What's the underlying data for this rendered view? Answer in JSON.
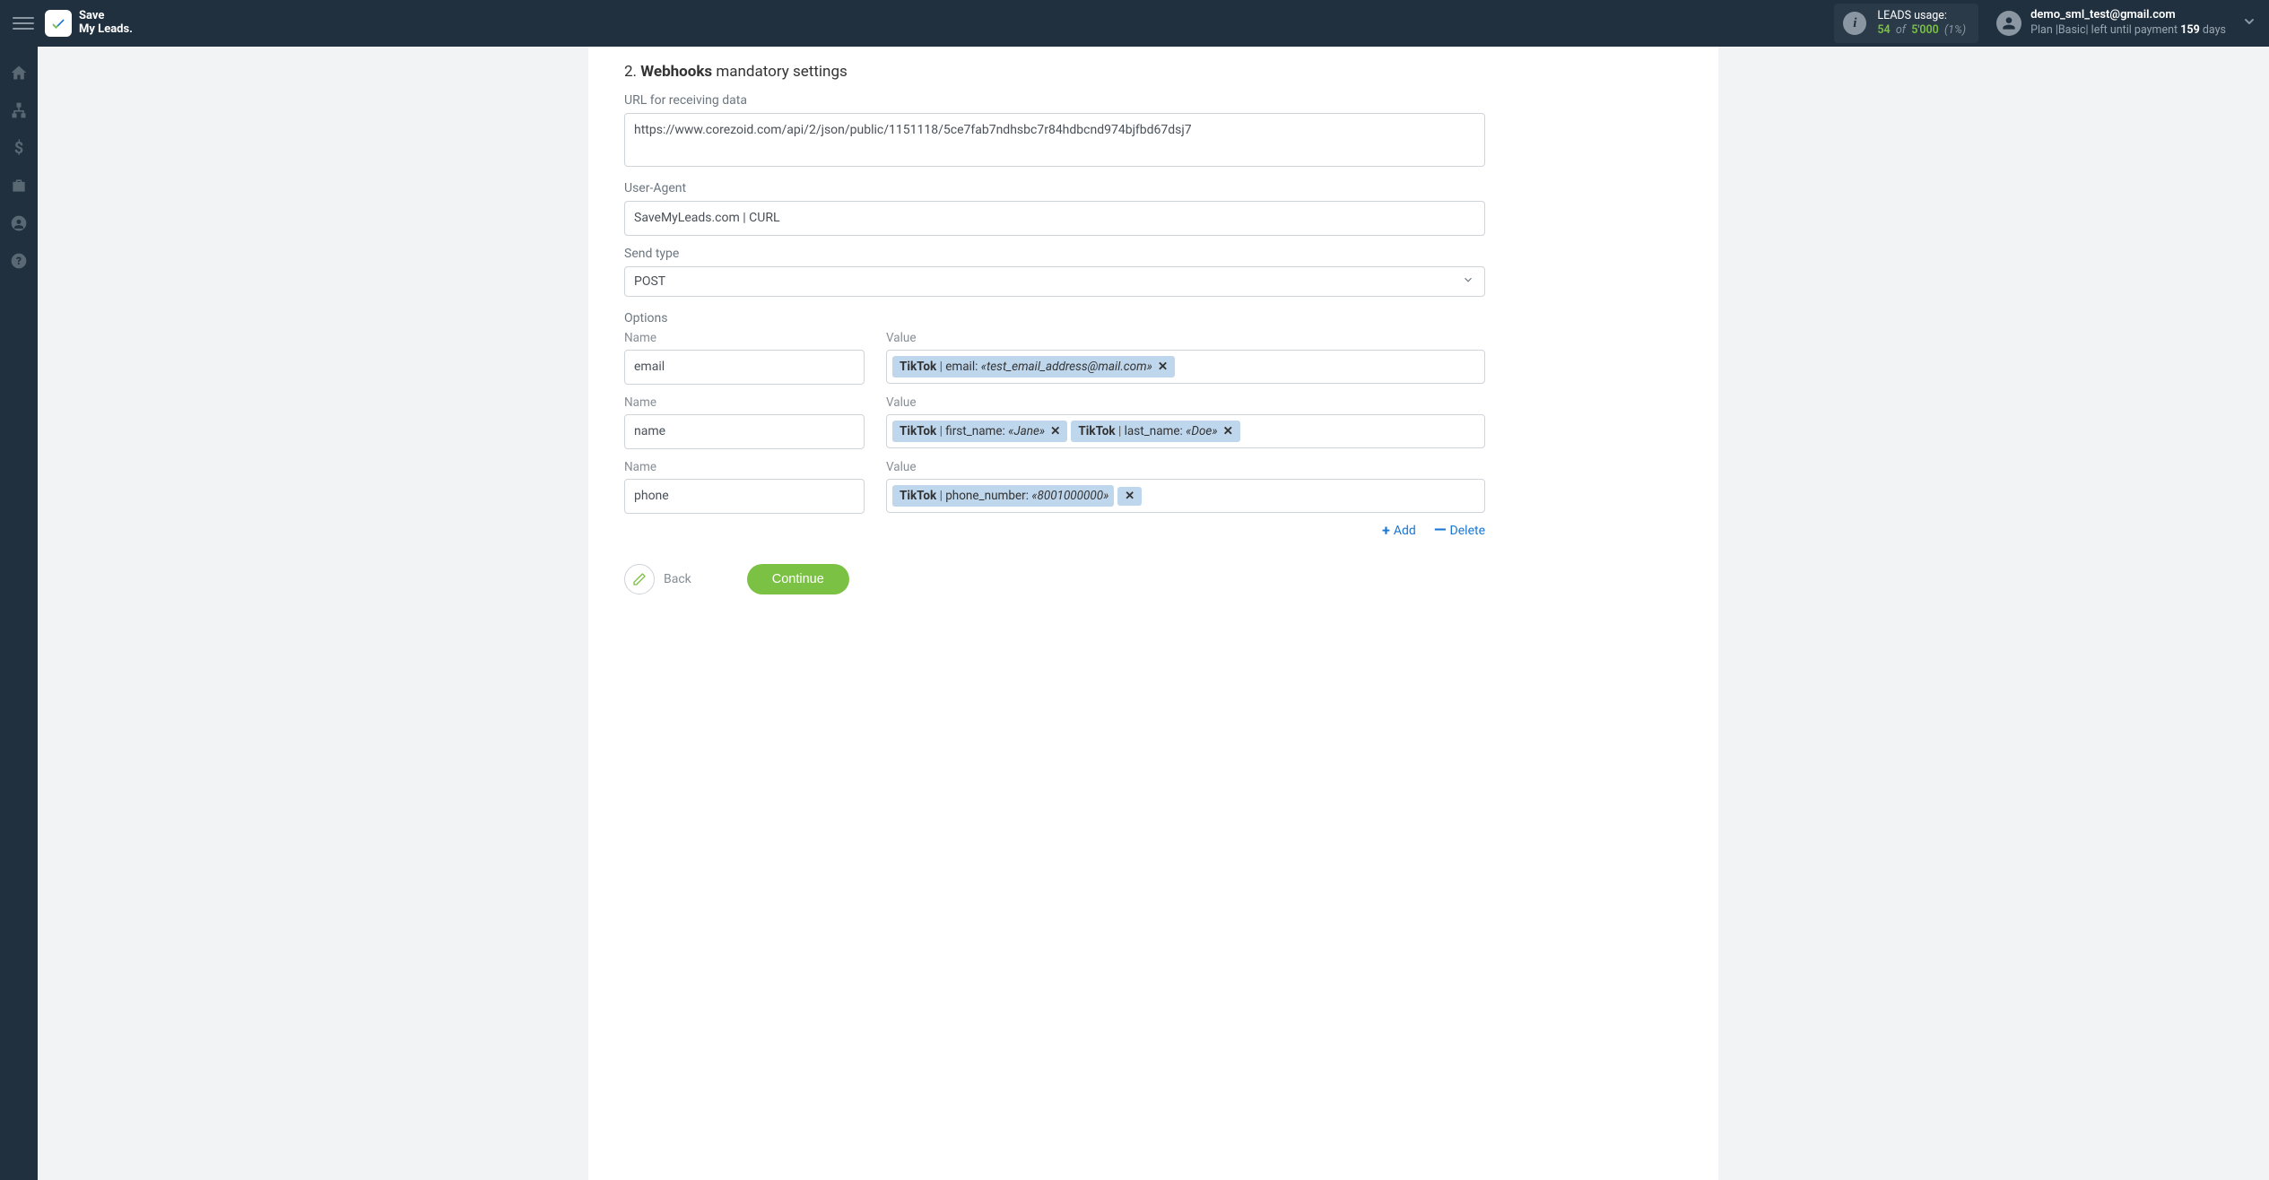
{
  "brand": {
    "line1": "Save",
    "line2": "My Leads."
  },
  "usage": {
    "label": "LEADS usage:",
    "used": "54",
    "of": "of",
    "limit": "5'000",
    "percent": "(1%)"
  },
  "user": {
    "email": "demo_sml_test@gmail.com",
    "plan_prefix": "Plan |",
    "plan_name": "Basic",
    "plan_mid": "| left until payment ",
    "days": "159",
    "days_suffix": " days"
  },
  "section": {
    "number": "2.",
    "word": "Webhooks",
    "rest": "mandatory settings"
  },
  "labels": {
    "url": "URL for receiving data",
    "user_agent": "User-Agent",
    "send_type": "Send type",
    "options": "Options",
    "name": "Name",
    "value": "Value"
  },
  "fields": {
    "url": "https://www.corezoid.com/api/2/json/public/1151118/5ce7fab7ndhsbc7r84hdbcnd974bjfbd67dsj7",
    "user_agent": "SaveMyLeads.com | CURL",
    "send_type": "POST"
  },
  "options": [
    {
      "name": "email",
      "tags": [
        {
          "source": "TikTok",
          "field": "email",
          "value": "«test_email_address@mail.com»"
        }
      ]
    },
    {
      "name": "name",
      "tags": [
        {
          "source": "TikTok",
          "field": "first_name",
          "value": "«Jane»"
        },
        {
          "source": "TikTok",
          "field": "last_name",
          "value": "«Doe»"
        }
      ]
    },
    {
      "name": "phone",
      "tags": [
        {
          "source": "TikTok",
          "field": "phone_number",
          "value": "«8001000000»",
          "separate_x": true
        }
      ]
    }
  ],
  "actions": {
    "add": "Add",
    "delete": "Delete",
    "back": "Back",
    "continue": "Continue"
  }
}
